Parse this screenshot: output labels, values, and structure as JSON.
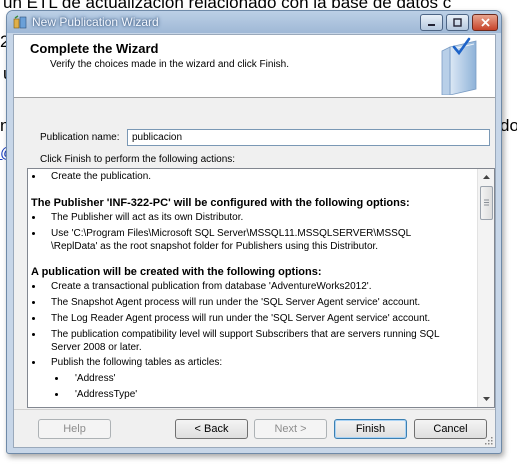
{
  "background": {
    "line1": "un ETL de actualización relacionado con la base de datos c",
    "fragment_2": "2",
    "fragment_u": "u",
    "fragment_n": "n",
    "fragment_do": "do",
    "fragment_at": "@"
  },
  "window": {
    "title": "New Publication Wizard",
    "minimize_icon": "minimize-icon",
    "maximize_icon": "maximize-icon",
    "close_icon": "close-icon"
  },
  "header": {
    "title": "Complete the Wizard",
    "subtitle": "Verify the choices made in the wizard and click Finish."
  },
  "form": {
    "publication_name_label": "Publication name:",
    "publication_name_value": "publicacion",
    "actions_label": "Click Finish to perform the following actions:"
  },
  "actions": {
    "item_create": "Create the publication.",
    "publisher_heading": "The Publisher 'INF-322-PC' will be configured with the following options:",
    "publisher_distributor": "The Publisher will act as its own Distributor.",
    "publisher_snapshot_1": "Use 'C:\\Program Files\\Microsoft SQL Server\\MSSQL11.MSSQLSERVER\\MSSQL",
    "publisher_snapshot_2": "\\ReplData' as the root snapshot folder for Publishers using this Distributor.",
    "publication_heading": "A publication will be created with the following options:",
    "pub_transactional": "Create a transactional publication from database 'AdventureWorks2012'.",
    "pub_snapshot_agent": "The Snapshot Agent process will run under the 'SQL Server Agent service' account.",
    "pub_log_reader": "The Log Reader Agent process will run under the 'SQL Server Agent service' account.",
    "pub_compat_1": "The publication compatibility level will support Subscribers that are servers running SQL",
    "pub_compat_2": "Server 2008 or later.",
    "pub_tables": "Publish the following tables as articles:",
    "table_address": "'Address'",
    "table_addresstype": "'AddressType'"
  },
  "buttons": {
    "help": "Help",
    "back": "< Back",
    "next": "Next >",
    "finish": "Finish",
    "cancel": "Cancel"
  },
  "colors": {
    "accent": "#3c7fb1",
    "titlebar": "#9fb8d6"
  }
}
